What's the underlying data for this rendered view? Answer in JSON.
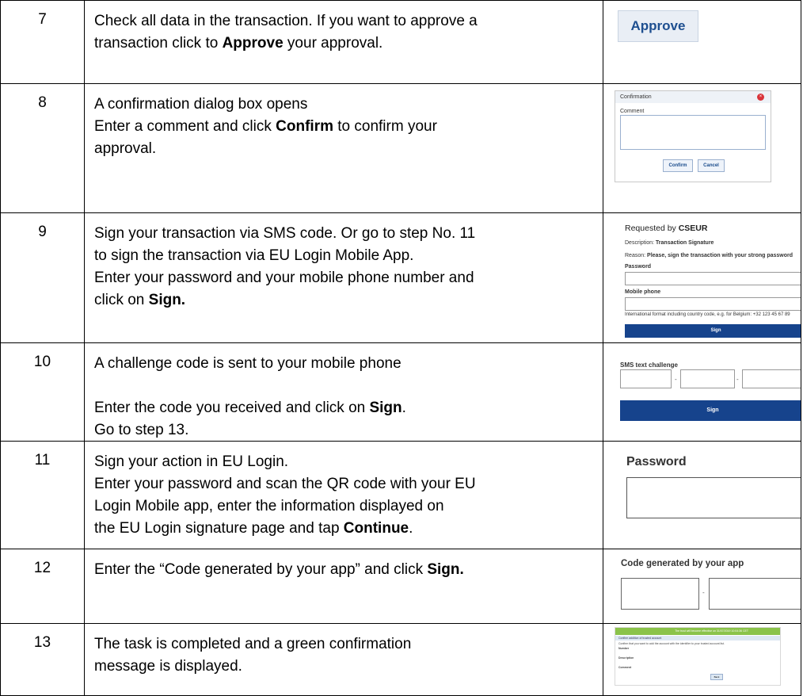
{
  "rows": [
    {
      "num": "7",
      "lines": [
        [
          "Check all data in the transaction. If you want to approve a"
        ],
        [
          "transaction click to ",
          {
            "b": "Approve"
          },
          " your approval."
        ]
      ],
      "visual": {
        "approve_button": "Approve"
      }
    },
    {
      "num": "8",
      "lines": [
        [
          "A confirmation dialog box opens"
        ],
        [
          "Enter a comment and click ",
          {
            "b": "Confirm"
          },
          " to confirm your"
        ],
        [
          "approval."
        ]
      ],
      "visual": {
        "title": "Confirmation",
        "comment_label": "Comment",
        "confirm": "Confirm",
        "cancel": "Cancel"
      }
    },
    {
      "num": "9",
      "lines": [
        [
          "Sign your transaction via SMS code. Or go to step No. 11"
        ],
        [
          "to sign the transaction via EU Login Mobile App."
        ],
        [
          "Enter your password and your mobile phone number and"
        ],
        [
          "click on ",
          {
            "b": "Sign."
          }
        ]
      ],
      "visual": {
        "requested_by": "Requested by",
        "requested_by_name": "CSEUR",
        "description_label": "Description:",
        "description": "Transaction Signature",
        "reason_label": "Reason:",
        "reason": "Please, sign the transaction with your strong password",
        "password_label": "Password",
        "mobile_label": "Mobile phone",
        "hint": "International format including country code, e.g. for Belgium: +32 123 45 67 89",
        "sign": "Sign"
      }
    },
    {
      "num": "10",
      "lines": [
        [
          "A challenge code is sent to your mobile phone"
        ],
        [
          ""
        ],
        [
          "Enter the code you received and click on ",
          {
            "b": "Sign"
          },
          "."
        ],
        [
          "Go to step 13."
        ]
      ],
      "visual": {
        "title": "SMS text challenge",
        "sign": "Sign",
        "dash": "-"
      }
    },
    {
      "num": "11",
      "lines": [
        [
          "Sign your action in EU Login."
        ],
        [
          "Enter your password and scan the QR code with your EU"
        ],
        [
          "Login Mobile app, enter the information displayed on"
        ],
        [
          "the EU Login signature page and tap ",
          {
            "b": "Continue"
          },
          "."
        ]
      ],
      "visual": {
        "title": "Password"
      }
    },
    {
      "num": "12",
      "lines": [
        [
          "Enter the “Code generated by your app” and click ",
          {
            "b": "Sign."
          }
        ]
      ],
      "visual": {
        "title": "Code generated by your app",
        "dash": "-"
      }
    },
    {
      "num": "13",
      "lines": [
        [
          "The task is completed and a green confirmation"
        ],
        [
          "message is displayed."
        ]
      ],
      "visual": {
        "banner": "The trust will become effective on 31/07/2019 10:04:36 CET",
        "sub": "Confirm addition of trusted account",
        "body": "Confirm that you want to add the account with the identifier to your trusted account list.",
        "f1": "Number",
        "f2": "Description",
        "f3": "Comment",
        "btn": "Back"
      }
    }
  ]
}
